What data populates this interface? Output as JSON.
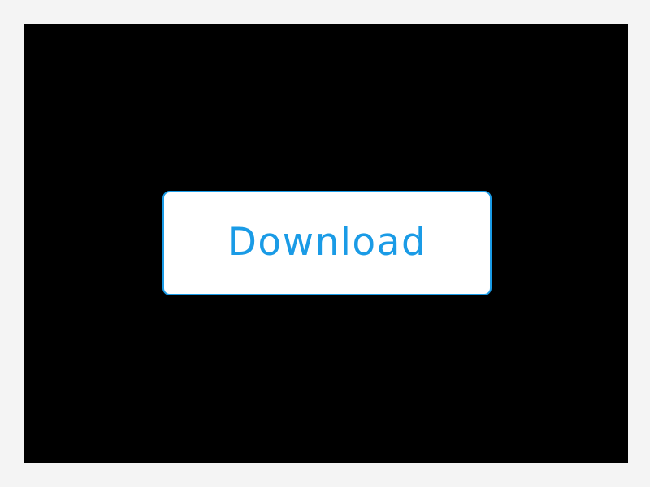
{
  "button": {
    "label": "Download"
  },
  "colors": {
    "page_background": "#f4f4f4",
    "canvas_background": "#000000",
    "button_background": "#ffffff",
    "accent": "#1a9be6"
  }
}
